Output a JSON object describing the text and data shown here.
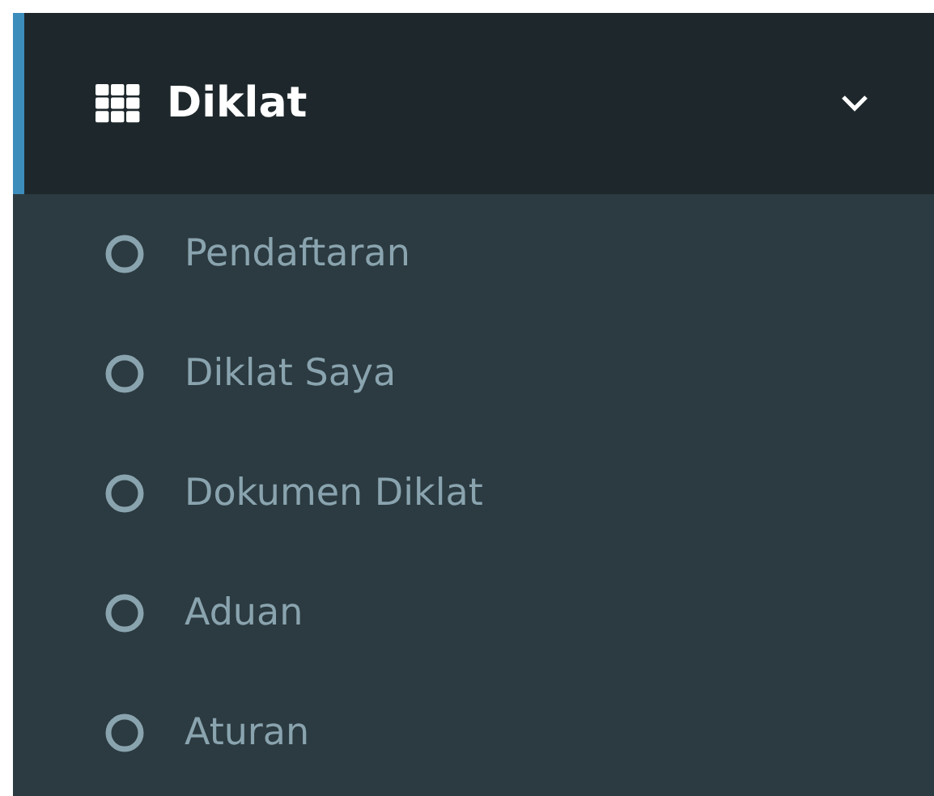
{
  "menu": {
    "label": "Diklat",
    "active": true,
    "expanded": true,
    "items": [
      {
        "label": "Pendaftaran"
      },
      {
        "label": "Diklat Saya"
      },
      {
        "label": "Dokumen Diklat"
      },
      {
        "label": "Aduan"
      },
      {
        "label": "Aturan"
      }
    ]
  }
}
